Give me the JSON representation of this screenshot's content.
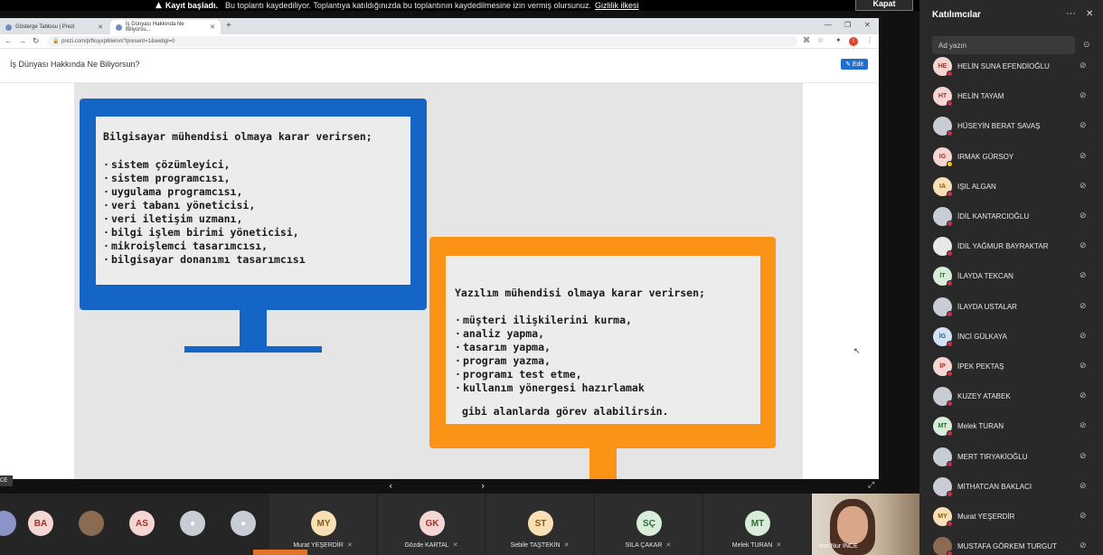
{
  "recording_banner": {
    "warn_icon": "warning-triangle-icon",
    "bold_text": "Kayıt başladı.",
    "message": "Bu toplantı kaydediliyor. Toplantıya katıldığınızda bu toplantının kaydedilmesine izin vermiş olursunuz.",
    "link": "Gizlilik ilkesi",
    "close_label": "Kapat"
  },
  "browser": {
    "tabs": [
      {
        "title": "Gösterge Tablosu | Prezi",
        "active": false
      },
      {
        "title": "İş Dünyası Hakkında Ne Biliyorsu...",
        "active": true
      }
    ],
    "url": "prezi.com/p/fkuyxp6lwnvt/?present=1&webgl=0"
  },
  "prezi": {
    "title": "İş Dünyası Hakkında Ne Biliyorsun?",
    "edit_label": "✎ Edit",
    "blue_monitor": {
      "heading": "Bilgisayar mühendisi olmaya karar verirsen;",
      "items": [
        "sistem çözümleyici,",
        "sistem programcısı,",
        "uygulama programcısı,",
        "veri tabanı yöneticisi,",
        "veri iletişim uzmanı,",
        "bilgi işlem birimi yöneticisi,",
        "mikroişlemci tasarımcısı,",
        "bilgisayar donanımı tasarımcısı"
      ]
    },
    "orange_monitor": {
      "heading": "Yazılım mühendisi olmaya karar verirsen;",
      "items": [
        "müşteri ilişkilerini kurma,",
        "analiz yapma,",
        "tasarım yapma,",
        "program yazma,",
        "programı test etme,",
        "kullanım yönergesi hazırlamak"
      ],
      "footer": "gibi alanlarda görev alabilirsin."
    }
  },
  "left_name_tag": "CE",
  "gallery": {
    "small_avatars": [
      {
        "initials": "BA",
        "bg": "#f6d6d2",
        "fg": "#a3312a"
      },
      {
        "initials": "",
        "bg": "#8a6a50",
        "fg": "#ffffff"
      },
      {
        "initials": "AS",
        "bg": "#f6d6d2",
        "fg": "#a3312a"
      },
      {
        "initials": "",
        "bg": "#c8ccd4",
        "fg": "#ffffff"
      },
      {
        "initials": "",
        "bg": "#c8ccd4",
        "fg": "#ffffff"
      }
    ],
    "tiles": [
      {
        "initials": "MY",
        "name": "Murat YEŞERDİR",
        "bg": "#f9dfb5",
        "fg": "#8a5a12"
      },
      {
        "initials": "GK",
        "name": "Gözde KARTAL",
        "bg": "#f6d6d2",
        "fg": "#a3312a"
      },
      {
        "initials": "ST",
        "name": "Sebile TAŞTEKİN",
        "bg": "#f9dfb5",
        "fg": "#8a5a12"
      },
      {
        "initials": "SÇ",
        "name": "SILA ÇAKAR",
        "bg": "#d7ecd9",
        "fg": "#2d6b33"
      },
      {
        "initials": "MT",
        "name": "Melek TURAN",
        "bg": "#d7ecd9",
        "fg": "#2d6b33"
      }
    ],
    "video_name": "İnci Nur İNCE"
  },
  "participants": {
    "title": "Katılımcılar",
    "search_placeholder": "Ad yazın",
    "list": [
      {
        "initials": "HE",
        "name": "HELİN SUNA EFENDİOĞLU",
        "bg": "#f6d6d2",
        "fg": "#a3312a",
        "status": "#c4314b"
      },
      {
        "initials": "HT",
        "name": "HELİN TAYAM",
        "bg": "#f6d6d2",
        "fg": "#a3312a",
        "status": "#c4314b"
      },
      {
        "initials": "",
        "name": "HÜSEYİN BERAT SAVAŞ",
        "bg": "#c8ccd4",
        "fg": "#ffffff",
        "status": "#c4314b"
      },
      {
        "initials": "IG",
        "name": "IRMAK GÜRSOY",
        "bg": "#f6d6d2",
        "fg": "#a3312a",
        "status": "#f8c12c"
      },
      {
        "initials": "IA",
        "name": "IŞIL ALGAN",
        "bg": "#f9dfb5",
        "fg": "#8a5a12",
        "status": "#c4314b"
      },
      {
        "initials": "",
        "name": "İDİL KANTARCIOĞLU",
        "bg": "#c8ccd4",
        "fg": "#ffffff",
        "status": "#c4314b"
      },
      {
        "initials": "",
        "name": "İDİL YAĞMUR BAYRAKTAR",
        "bg": "#e8e8e8",
        "fg": "#555555",
        "status": "#c4314b"
      },
      {
        "initials": "İT",
        "name": "İLAYDA TEKCAN",
        "bg": "#d7ecd9",
        "fg": "#2d6b33",
        "status": "#c4314b"
      },
      {
        "initials": "",
        "name": "İLAYDA USTALAR",
        "bg": "#c8ccd4",
        "fg": "#ffffff",
        "status": "#c4314b"
      },
      {
        "initials": "İG",
        "name": "İNCİ GÜLKAYA",
        "bg": "#d3e3f5",
        "fg": "#2b5a8e",
        "status": "#c4314b"
      },
      {
        "initials": "İP",
        "name": "İPEK PEKTAŞ",
        "bg": "#f6d6d2",
        "fg": "#a3312a",
        "status": "#c4314b"
      },
      {
        "initials": "",
        "name": "KUZEY ATABEK",
        "bg": "#c8ccd4",
        "fg": "#ffffff",
        "status": "#c4314b"
      },
      {
        "initials": "MT",
        "name": "Melek TURAN",
        "bg": "#d7ecd9",
        "fg": "#2d6b33",
        "status": "#c4314b"
      },
      {
        "initials": "",
        "name": "MERT TIRYAKİOĞLU",
        "bg": "#c8ccd4",
        "fg": "#ffffff",
        "status": "#c4314b"
      },
      {
        "initials": "",
        "name": "MİTHATCAN BAKLACI",
        "bg": "#c8ccd4",
        "fg": "#ffffff",
        "status": "#c4314b"
      },
      {
        "initials": "MY",
        "name": "Murat YEŞERDİR",
        "bg": "#f9dfb5",
        "fg": "#8a5a12",
        "status": "#c4314b"
      },
      {
        "initials": "",
        "name": "MUSTAFA GÖRKEM TURGUT",
        "bg": "#8a6a50",
        "fg": "#ffffff",
        "status": "#c4314b"
      }
    ]
  }
}
